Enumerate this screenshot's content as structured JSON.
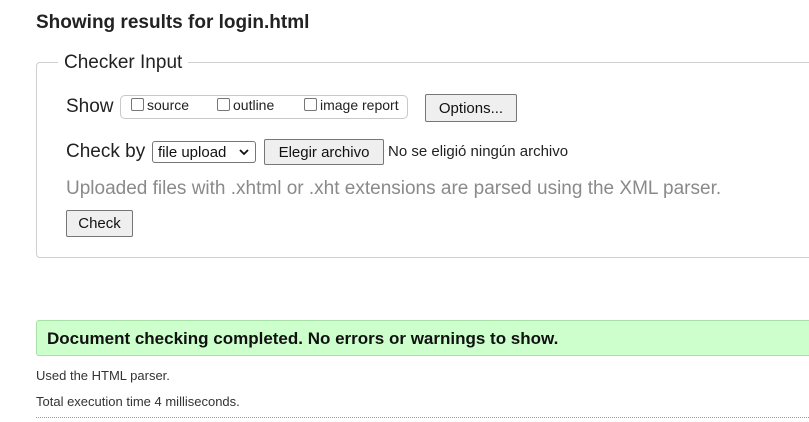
{
  "heading": "Showing results for login.html",
  "checker": {
    "legend": "Checker Input",
    "show_label": "Show",
    "show_options": [
      {
        "label": "source",
        "checked": false
      },
      {
        "label": "outline",
        "checked": false
      },
      {
        "label": "image report",
        "checked": false
      }
    ],
    "options_button": "Options...",
    "check_by_label": "Check by",
    "check_by_selected": "file upload",
    "choose_file_button": "Elegir archivo",
    "no_file_text": "No se eligió ningún archivo",
    "hint": "Uploaded files with .xhtml or .xht extensions are parsed using the XML parser.",
    "check_button": "Check"
  },
  "result": {
    "message": "Document checking completed. No errors or warnings to show.",
    "parser": "Used the HTML parser.",
    "execution_time": "Total execution time 4 milliseconds.",
    "success_color": "#ccffcc"
  }
}
